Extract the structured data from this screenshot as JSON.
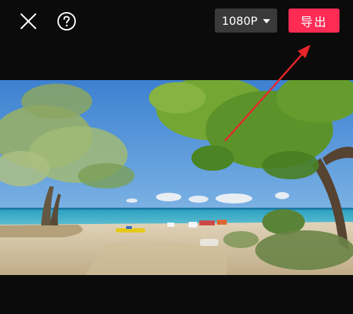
{
  "toolbar": {
    "close_icon": "close-icon",
    "help_icon": "question-circle-icon",
    "resolution": "1080P",
    "export_label": "导出"
  },
  "colors": {
    "background": "#0b0b0b",
    "resolution_bg": "#3a3a3a",
    "export_bg": "#fe2c55",
    "annotation_arrow": "#e8262b"
  },
  "preview": {
    "description_icon": "video-preview"
  }
}
